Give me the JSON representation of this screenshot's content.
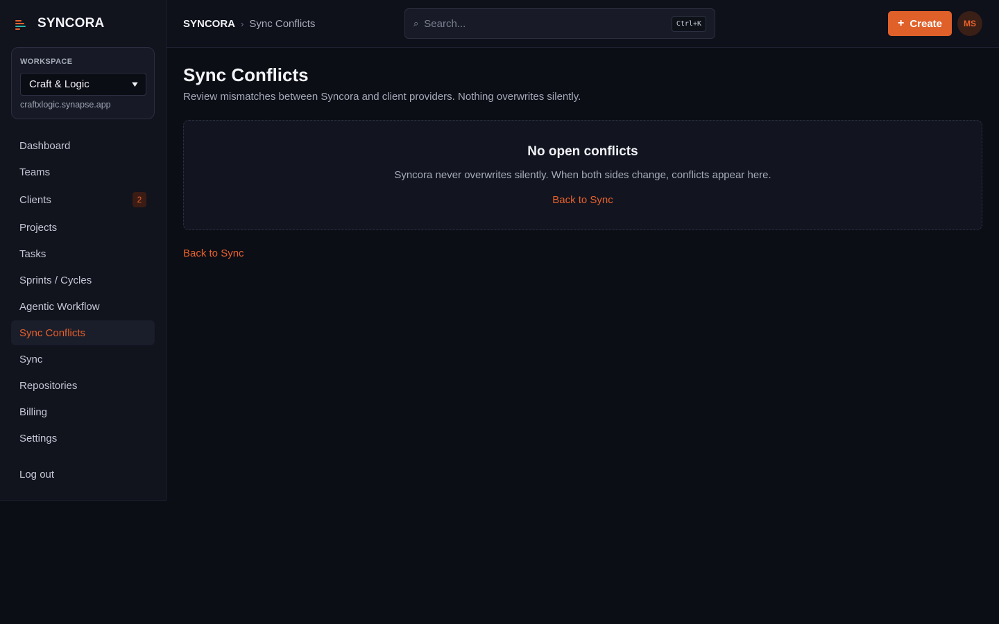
{
  "brand": {
    "name": "SYNCORA"
  },
  "workspace": {
    "label": "WORKSPACE",
    "selected": "Craft & Logic",
    "domain": "craftxlogic.synapse.app"
  },
  "sidebar": {
    "items": [
      {
        "label": "Dashboard"
      },
      {
        "label": "Teams"
      },
      {
        "label": "Clients",
        "badge": "2"
      },
      {
        "label": "Projects"
      },
      {
        "label": "Tasks"
      },
      {
        "label": "Sprints / Cycles"
      },
      {
        "label": "Agentic Workflow"
      },
      {
        "label": "Sync Conflicts",
        "active": true
      },
      {
        "label": "Sync"
      },
      {
        "label": "Repositories"
      },
      {
        "label": "Billing"
      },
      {
        "label": "Settings"
      }
    ],
    "logout": "Log out"
  },
  "header": {
    "breadcrumb_root": "SYNCORA",
    "breadcrumb_sep": "›",
    "breadcrumb_current": "Sync Conflicts",
    "search_placeholder": "Search...",
    "search_shortcut": "Ctrl+K",
    "create_label": "Create",
    "avatar_initials": "MS"
  },
  "page": {
    "title": "Sync Conflicts",
    "subtitle": "Review mismatches between Syncora and client providers. Nothing overwrites silently.",
    "empty_title": "No open conflicts",
    "empty_text": "Syncora never overwrites silently. When both sides change, conflicts appear here.",
    "empty_link": "Back to Sync",
    "back_link": "Back to Sync"
  },
  "colors": {
    "accent": "#e0602a",
    "background": "#0c0e16",
    "sidebar": "#11131d"
  }
}
